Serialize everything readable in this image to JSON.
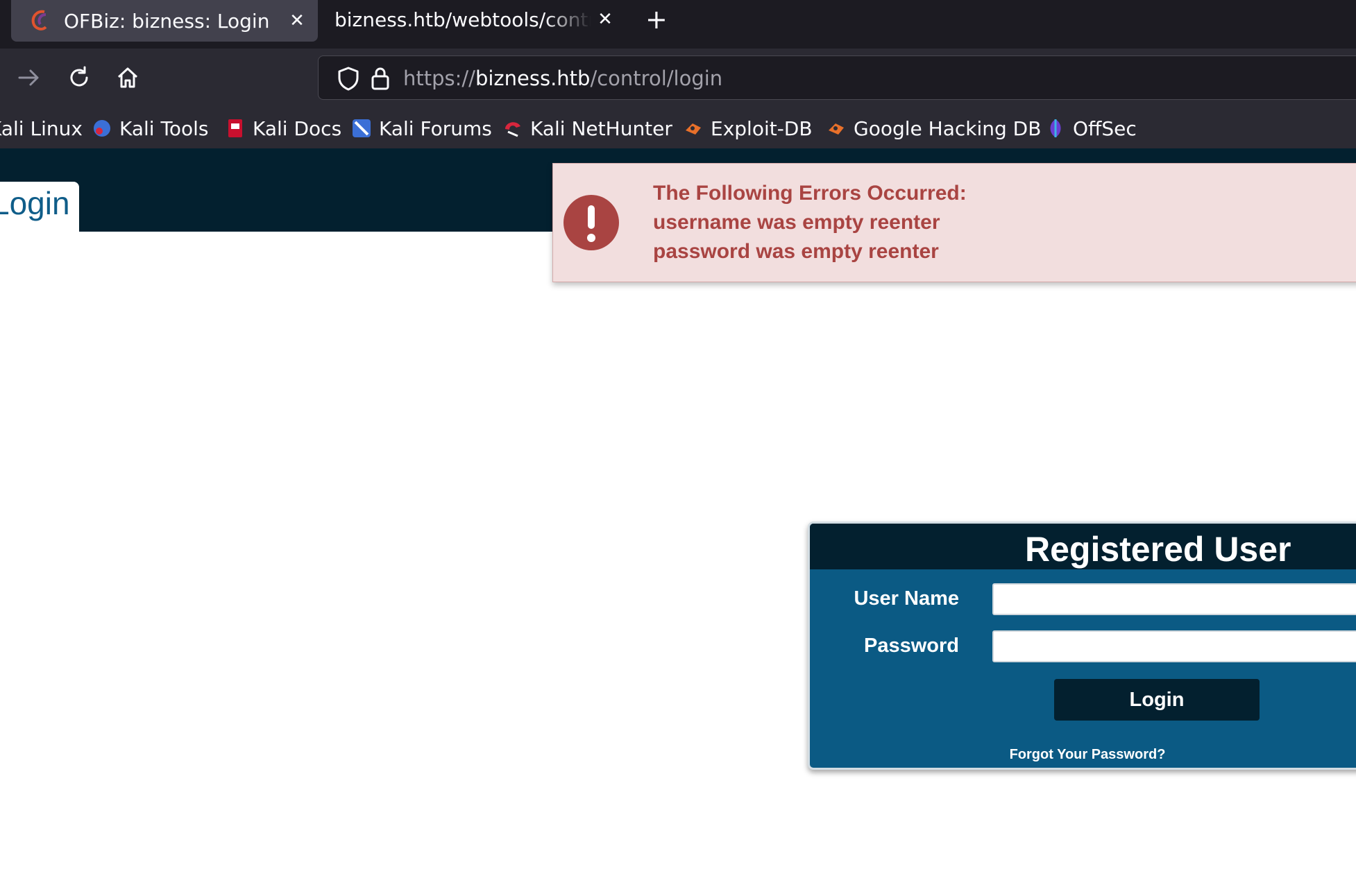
{
  "browser": {
    "tabs": [
      {
        "label": "OFBiz: bizness: Login",
        "active": true
      },
      {
        "label": "bizness.htb/webtools/control/",
        "active": false
      }
    ],
    "close_glyph": "✕",
    "new_tab_glyph": "+",
    "url": {
      "scheme": "https://",
      "host": "bizness.htb",
      "path": "/control/login"
    },
    "bookmarks": [
      {
        "label": "Kali Linux",
        "icon": "kali-linux-icon"
      },
      {
        "label": "Kali Tools",
        "icon": "kali-tools-icon"
      },
      {
        "label": "Kali Docs",
        "icon": "kali-docs-icon"
      },
      {
        "label": "Kali Forums",
        "icon": "kali-forums-icon"
      },
      {
        "label": "Kali NetHunter",
        "icon": "kali-nethunter-icon"
      },
      {
        "label": "Exploit-DB",
        "icon": "exploit-db-icon"
      },
      {
        "label": "Google Hacking DB",
        "icon": "google-hacking-db-icon"
      },
      {
        "label": "OffSec",
        "icon": "offsec-icon"
      }
    ]
  },
  "page": {
    "header_tab": "Login",
    "error": {
      "heading": "The Following Errors Occurred:",
      "lines": [
        "username was empty reenter",
        "password was empty reenter"
      ]
    },
    "login_form": {
      "title": "Registered User",
      "username_label": "User Name",
      "username_value": "",
      "password_label": "Password",
      "password_value": "",
      "submit_label": "Login",
      "forgot_link": "Forgot Your Password?"
    }
  },
  "colors": {
    "header_bg": "#03202f",
    "form_bg": "#0b5a84",
    "error_bg": "#f2dede",
    "error_text": "#a94442",
    "link_blue": "#0f5d89"
  }
}
